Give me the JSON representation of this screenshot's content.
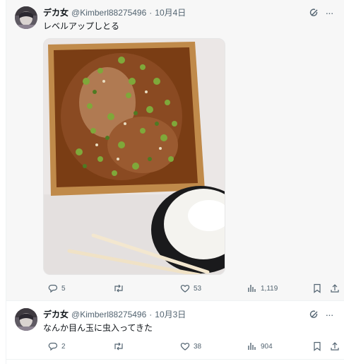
{
  "posts": [
    {
      "author_name": "デカ女",
      "handle": "@Kimberl88275496",
      "separator": "·",
      "date": "10月4日",
      "text": "レベルアップしとる",
      "more_glyph": "···",
      "media_description_icon": "photo-of-fried-chicken-with-green-onions-and-rice",
      "stats": {
        "replies": "5",
        "reposts": "",
        "likes": "53",
        "views": "1,119"
      }
    },
    {
      "author_name": "デカ女",
      "handle": "@Kimberl88275496",
      "separator": "·",
      "date": "10月3日",
      "text": "なんか目ん玉に虫入ってきた",
      "more_glyph": "···",
      "stats": {
        "replies": "2",
        "reposts": "",
        "likes": "38",
        "views": "904"
      }
    }
  ],
  "colors": {
    "text_primary": "#0f1419",
    "text_secondary": "#536471",
    "border": "#eff3f4",
    "post_hover_bg": "#f7f7f7"
  },
  "icons": [
    "grok-icon",
    "more-icon",
    "reply-icon",
    "repost-icon",
    "like-icon",
    "views-icon",
    "bookmark-icon",
    "share-icon"
  ]
}
